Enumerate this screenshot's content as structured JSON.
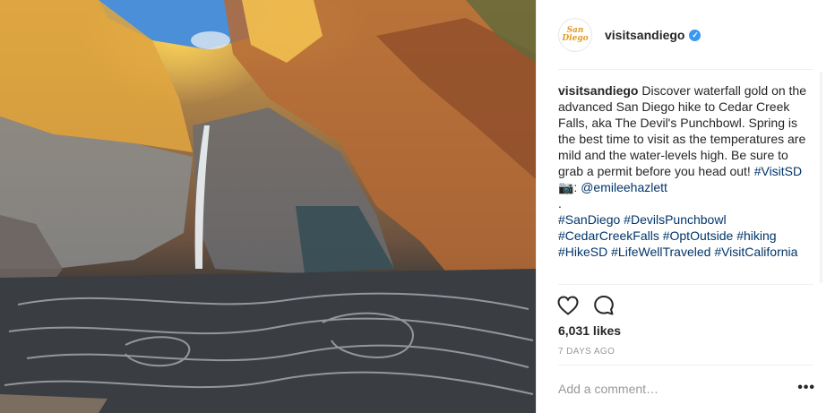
{
  "post": {
    "image_alt": "",
    "username": "visitsandiego",
    "verified": true,
    "avatar": {
      "text": "San Diego",
      "icon": "san-diego-logo-icon"
    }
  },
  "caption": {
    "user": "visitsandiego",
    "text": "Discover waterfall gold on the advanced San Diego hike to Cedar Creek Falls, aka The Devil's Punchbowl. Spring is the best time to visit as the temperatures are mild and the water-levels high. Be sure to grab a permit before you head out!",
    "hashtag_visitsd": "#VisitSD",
    "camera_emoji": "📷:",
    "mention": "@emileehazlett",
    "dot": ".",
    "hashtags": [
      "#SanDiego",
      "#DevilsPunchbowl",
      "#CedarCreekFalls",
      "#OptOutside",
      "#hiking",
      "#HikeSD",
      "#LifeWellTraveled",
      "#VisitCalifornia"
    ]
  },
  "actions": {
    "like_icon": "heart-icon",
    "comment_icon": "comment-icon"
  },
  "likes": "6,031 likes",
  "timestamp": "7 DAYS AGO",
  "comment": {
    "placeholder": "Add a comment…"
  },
  "more": "•••",
  "colors": {
    "link": "#003569",
    "verified": "#3897f0",
    "muted": "#999999"
  }
}
